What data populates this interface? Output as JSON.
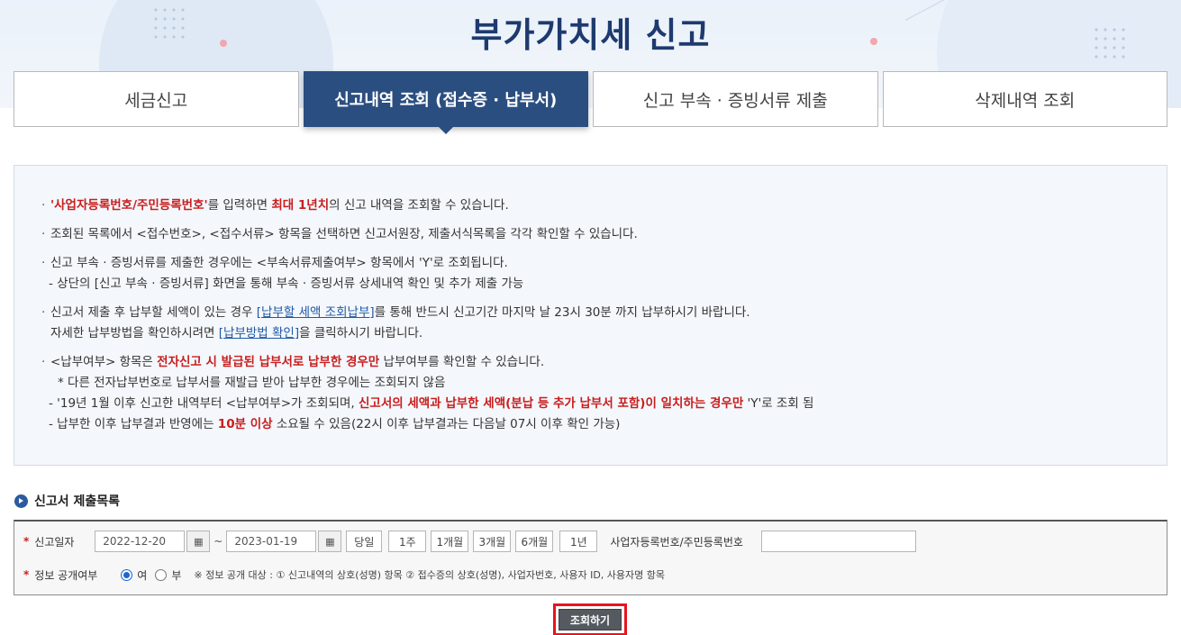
{
  "header": {
    "title": "부가가치세 신고"
  },
  "tabs": [
    {
      "label": "세금신고",
      "active": false
    },
    {
      "label": "신고내역 조회 (접수증 · 납부서)",
      "active": true
    },
    {
      "label": "신고 부속 · 증빙서류 제출",
      "active": false
    },
    {
      "label": "삭제내역 조회",
      "active": false
    }
  ],
  "notice": {
    "l1a": "'사업자등록번호/주민등록번호'",
    "l1b": "를 입력하면 ",
    "l1c": "최대 1년치",
    "l1d": "의 신고 내역을 조회할 수 있습니다.",
    "l2": "조회된 목록에서 <접수번호>, <접수서류> 항목을 선택하면 신고서원장, 제출서식목록을 각각 확인할 수 있습니다.",
    "l3": "신고 부속 · 증빙서류를 제출한 경우에는 <부속서류제출여부> 항목에서 'Y'로 조회됩니다.",
    "l3s": "- 상단의 [신고 부속 · 증빙서류] 화면을 통해 부속 · 증빙서류 상세내역 확인 및 추가 제출 가능",
    "l4a": "신고서 제출 후 납부할 세액이 있는 경우 ",
    "l4link": "[납부할 세액 조회납부]",
    "l4b": "를 통해 반드시 신고기간 마지막 날 23시 30분 까지 납부하시기 바랍니다.",
    "l4s_a": "자세한 납부방법을 확인하시려면 ",
    "l4s_link": "[납부방법 확인]",
    "l4s_b": "을 클릭하시기 바랍니다.",
    "l5a": "<납부여부> 항목은 ",
    "l5b": "전자신고 시 발급된 납부서로 납부한 경우만",
    "l5c": " 납부여부를 확인할 수 있습니다.",
    "l5s1": "* 다른 전자납부번호로 납부서를 재발급 받아 납부한 경우에는 조회되지 않음",
    "l5s2a": "- '19년 1월 이후 신고한 내역부터 <납부여부>가 조회되며, ",
    "l5s2b": "신고서의 세액과 납부한 세액(분납 등 추가 납부서 포함)이 일치하는 경우만",
    "l5s2c": " 'Y'로 조회 됨",
    "l5s3a": "- 납부한 이후 납부결과 반영에는 ",
    "l5s3b": "10분 이상",
    "l5s3c": " 소요될 수 있음(22시 이후 납부결과는 다음날 07시 이후 확인 가능)"
  },
  "section": {
    "title": "신고서 제출목록"
  },
  "form": {
    "date_label": "신고일자",
    "date_from": "2022-12-20",
    "date_to": "2023-01-19",
    "tilde": "~",
    "calendar_glyph": "▦",
    "periods": [
      "당일",
      "1주",
      "1개월",
      "3개월",
      "6개월",
      "1년"
    ],
    "id_label": "사업자등록번호/주민등록번호",
    "id_value": "",
    "disclosure_label": "정보 공개여부",
    "radio_yes": "여",
    "radio_no": "부",
    "disclosure_note": "※ 정보 공개 대상 : ① 신고내역의 상호(성명) 항목 ② 접수증의 상호(성명), 사업자번호, 사용자 ID, 사용자명 항목"
  },
  "actions": {
    "search_label": "조회하기"
  },
  "colors": {
    "accent": "#2b4e80",
    "title": "#1e3a6e",
    "highlight": "#c81e1e",
    "outline": "#e6141e"
  }
}
